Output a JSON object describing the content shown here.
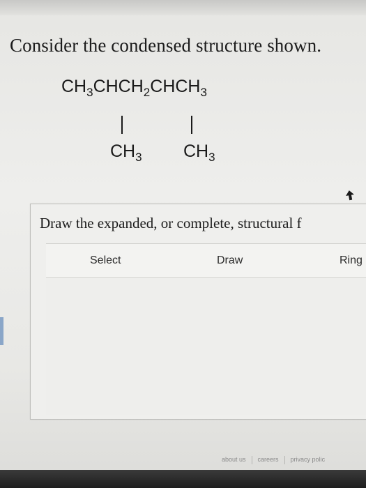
{
  "question": {
    "title": "Consider the condensed structure shown.",
    "formula": {
      "parts": [
        {
          "text": "CH"
        },
        {
          "sub": "3"
        },
        {
          "text": "CHCH"
        },
        {
          "sub": "2"
        },
        {
          "text": "CHCH"
        },
        {
          "sub": "3"
        }
      ],
      "branches": [
        {
          "text": "CH",
          "sub": "3"
        },
        {
          "text": "CH",
          "sub": "3"
        }
      ]
    }
  },
  "panel": {
    "prompt": "Draw the expanded, or complete, structural f",
    "tools": {
      "select": "Select",
      "draw": "Draw",
      "rings": "Ring"
    }
  },
  "footer": {
    "about": "about us",
    "careers": "careers",
    "privacy": "privacy polic"
  }
}
